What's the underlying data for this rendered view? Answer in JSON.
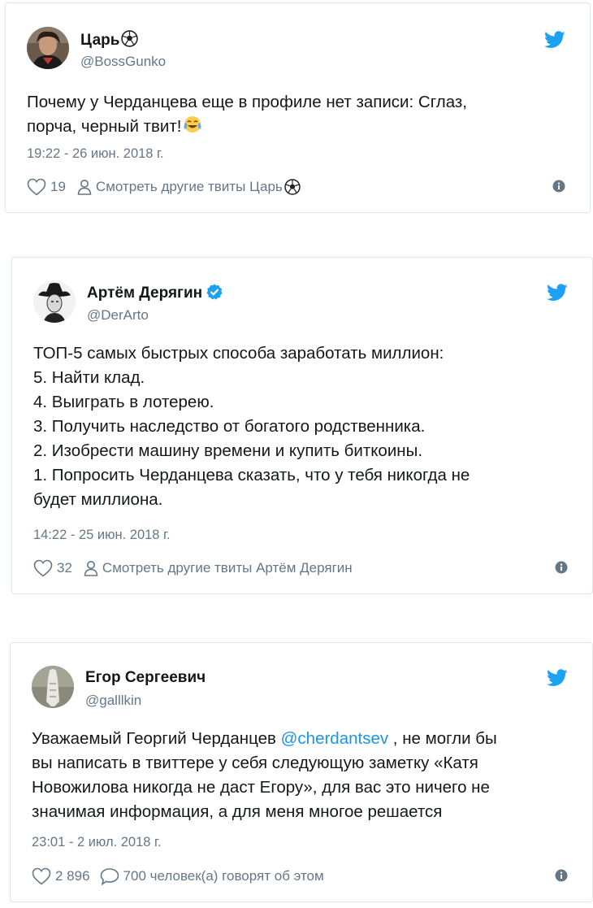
{
  "tweets": [
    {
      "author": {
        "name": "Царь",
        "name_emoji": "soccer-ball",
        "handle": "@BossGunko",
        "verified": false
      },
      "body_lines": [
        "Почему у Черданцева еще в профиле нет записи: Сглаз,",
        "порча, черный твит!"
      ],
      "body_end_emoji": "tears-of-joy",
      "timestamp": "19:22 - 26 июн. 2018 г.",
      "likes": "19",
      "secondary_action": "Смотреть другие твиты Царь",
      "secondary_emoji": "soccer-ball"
    },
    {
      "author": {
        "name": "Артём Дерягин",
        "handle": "@DerArto",
        "verified": true
      },
      "body_lines": [
        "ТОП-5 самых быстрых способа заработать миллион:",
        "5. Найти клад.",
        "4. Выиграть в лотерею.",
        "3. Получить наследство от богатого родственника.",
        "2. Изобрести машину времени и купить биткоины.",
        "1. Попросить Черданцева сказать, что у тебя никогда не",
        "будет миллиона."
      ],
      "timestamp": "14:22 - 25 июн. 2018 г.",
      "likes": "32",
      "secondary_action": "Смотреть другие твиты Артём Дерягин"
    },
    {
      "author": {
        "name": "Егор Сергеевич",
        "handle": "@galllkin",
        "verified": false
      },
      "body_line1_pre": "Уважаемый Георгий Черданцев ",
      "body_mention": "@cherdantsev",
      "body_line1_post": " , не могли бы",
      "body_lines": [
        "вы написать в твиттере у себя следующую заметку «Катя",
        "Новожилова никогда не даст Егору», для вас это ничего не",
        "значимая информация, а для меня многое решается"
      ],
      "timestamp": "23:01 - 2 июл. 2018 г.",
      "likes": "2 896",
      "secondary_action": "700 человек(а) говорят об этом"
    }
  ],
  "icons": {
    "bird": "twitter-bird-icon",
    "like": "heart-icon",
    "profile": "person-icon",
    "reply": "speech-bubble-icon",
    "info": "info-icon",
    "verified": "verified-badge-icon"
  },
  "colors": {
    "twitter_blue": "#1da1f2",
    "text": "#14171a",
    "secondary": "#657786",
    "mention": "#1b95e0",
    "border": "#e1e8ed"
  }
}
